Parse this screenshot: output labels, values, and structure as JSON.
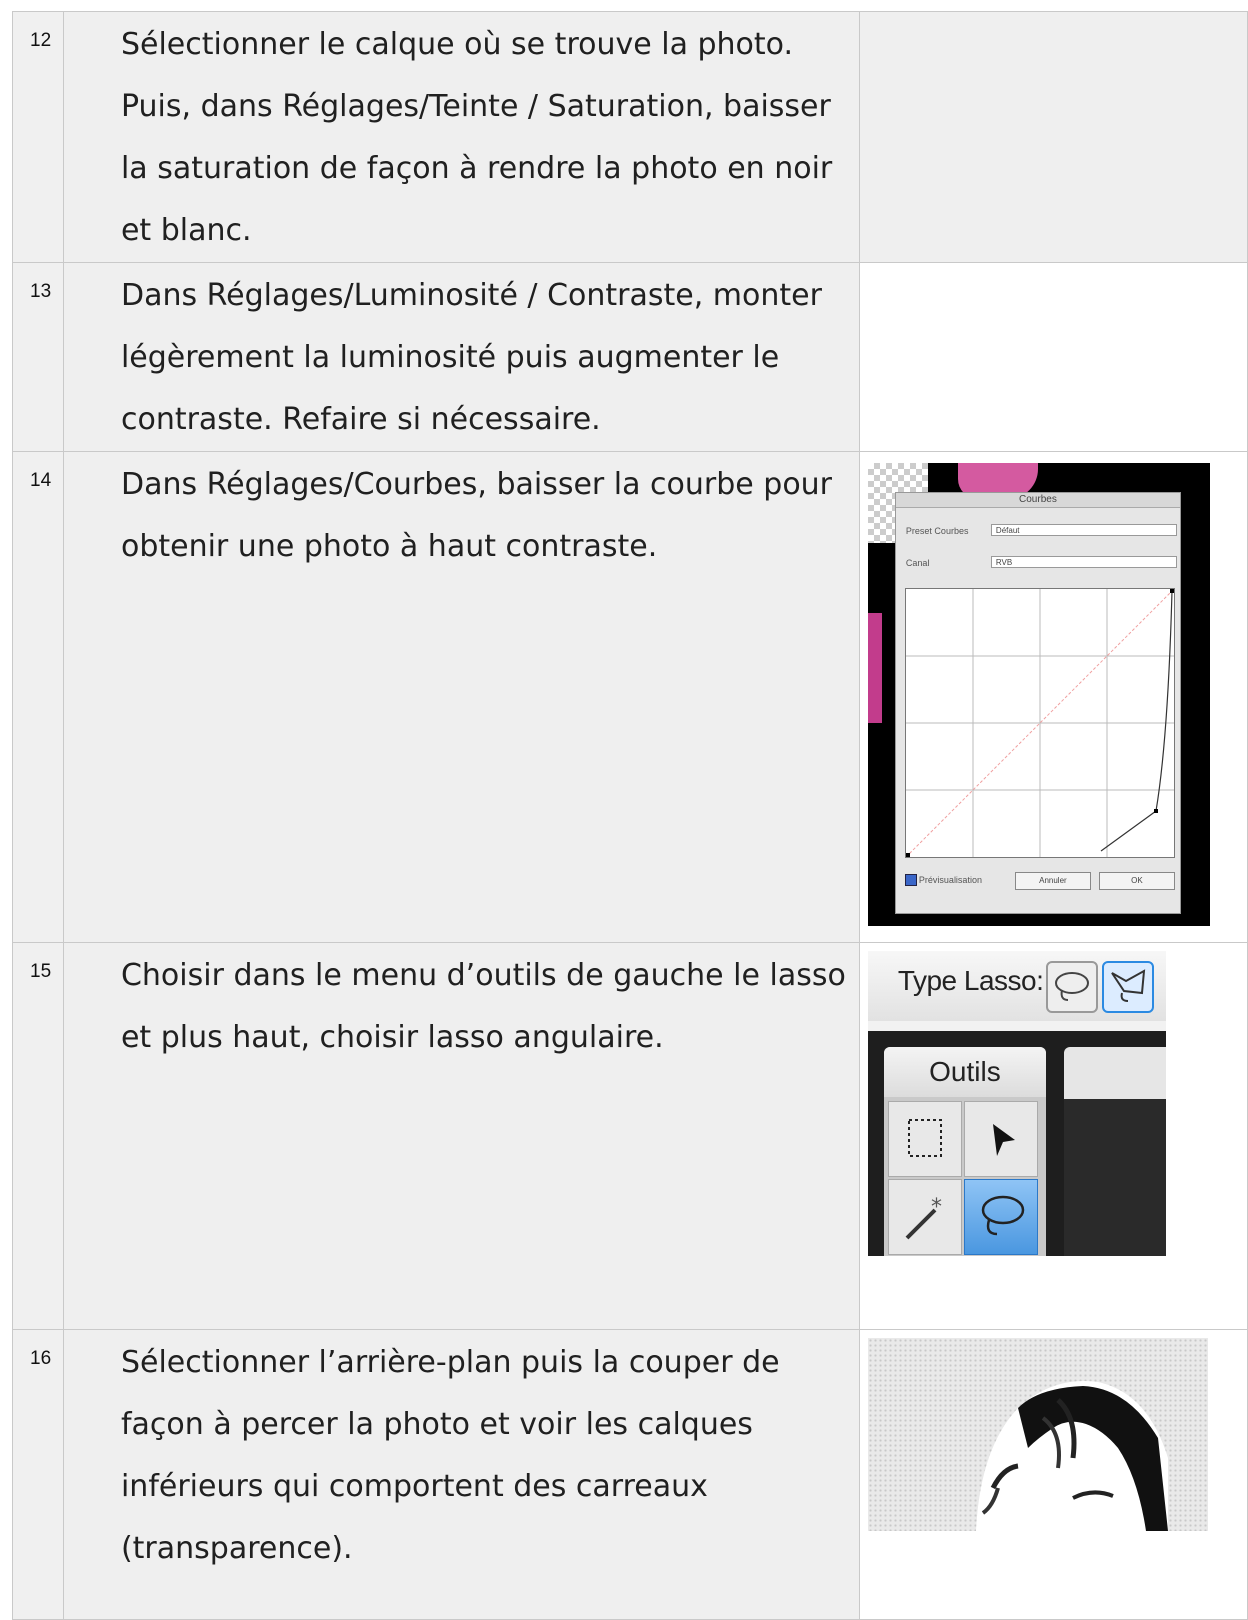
{
  "steps": [
    {
      "number": "12",
      "text": "Sélectionner le calque où se trouve la photo. Puis, dans Réglages/Teinte / Saturation, baisser la saturation de façon à rendre la photo en noir et blanc."
    },
    {
      "number": "13",
      "text": "Dans Réglages/Luminosité / Contraste, monter légèrement la luminosité puis augmenter le contraste. Refaire si nécessaire."
    },
    {
      "number": "14",
      "text": "Dans Réglages/Courbes, baisser la courbe pour obtenir une photo à haut contraste."
    },
    {
      "number": "15",
      "text": "Choisir dans le menu d’outils de gauche le lasso et plus haut, choisir lasso angulaire."
    },
    {
      "number": "16",
      "text": "Sélectionner l’arrière-plan puis la couper de façon à percer la photo et voir les calques inférieurs qui comportent des carreaux (transparence)."
    }
  ],
  "curves_dialog": {
    "title": "Courbes",
    "preset_label": "Preset Courbes",
    "preset_value": "Défaut",
    "channel_label": "Canal",
    "channel_value": "RVB",
    "preview_label": "Prévisualisation",
    "cancel_label": "Annuler",
    "ok_label": "OK"
  },
  "lasso_panel": {
    "type_label": "Type Lasso:",
    "tools_title": "Outils"
  }
}
